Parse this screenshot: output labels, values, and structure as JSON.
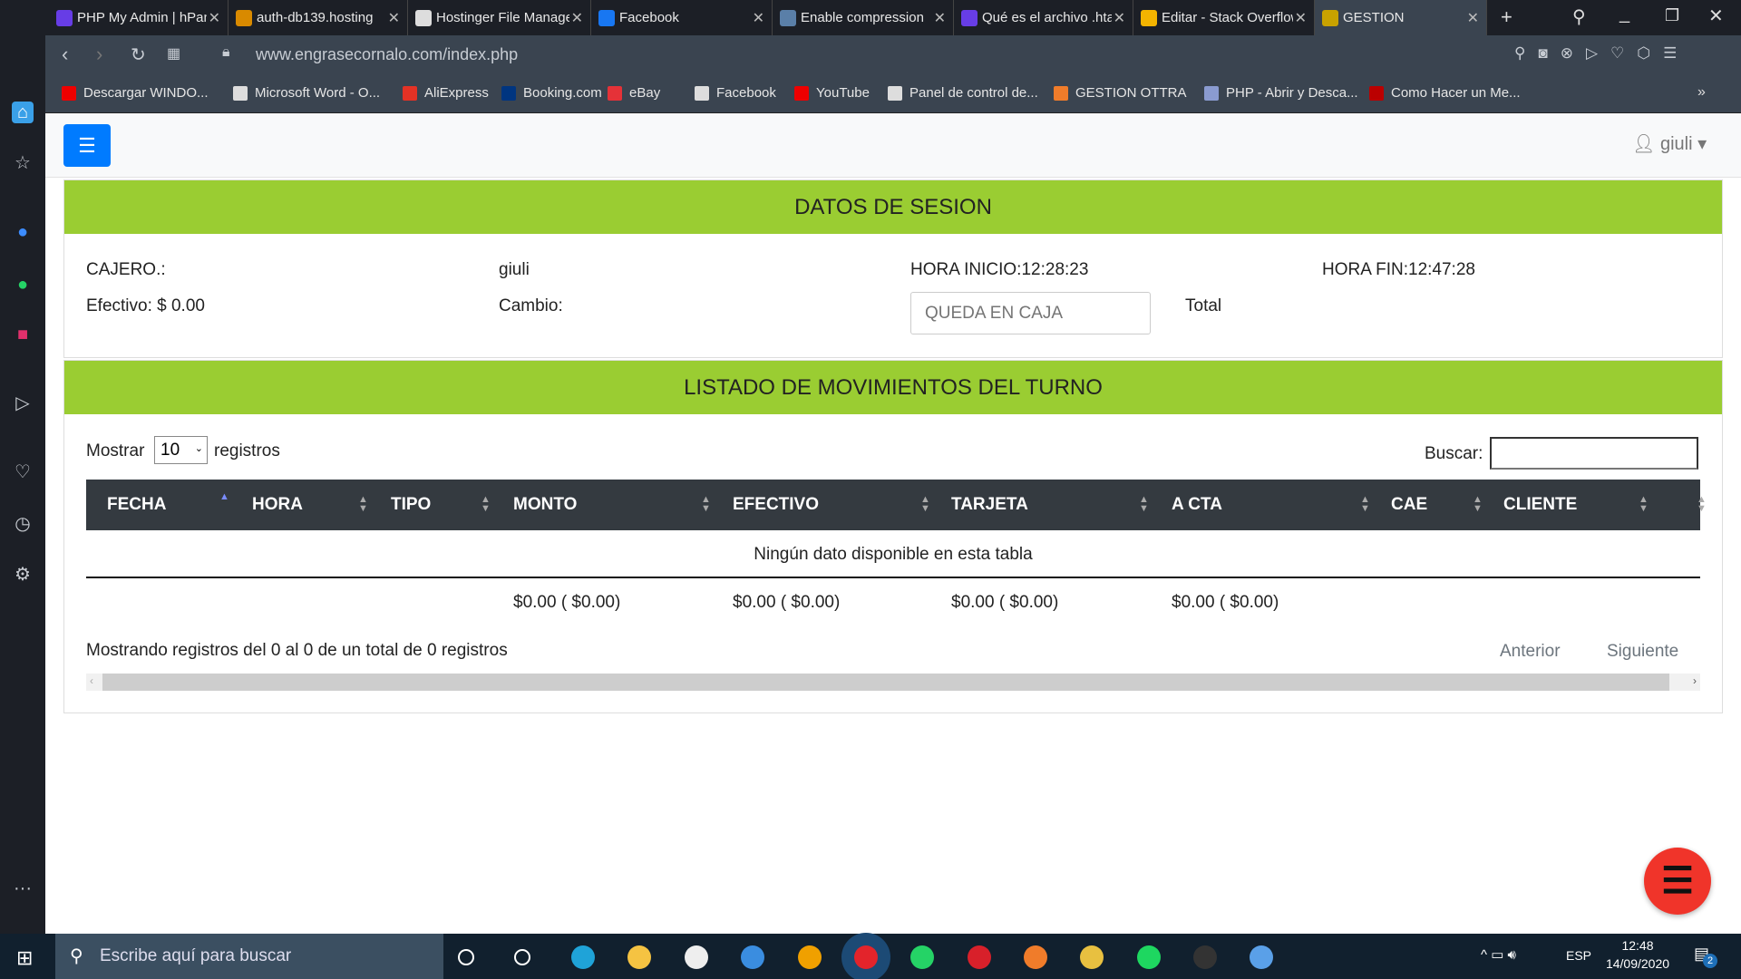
{
  "browser": {
    "tabs": [
      {
        "title": "PHP My Admin | hPanel",
        "color": "#673de6"
      },
      {
        "title": "auth-db139.hosting",
        "color": "#d98a00"
      },
      {
        "title": "Hostinger File Manager",
        "color": "#ddd"
      },
      {
        "title": "Facebook",
        "color": "#1877f2"
      },
      {
        "title": "Enable compression",
        "color": "#5a7fa8"
      },
      {
        "title": "Qué es el archivo .htaccess",
        "color": "#673de6"
      },
      {
        "title": "Editar - Stack Overflow",
        "color": "#f4b400"
      },
      {
        "title": "GESTION",
        "color": "#c8a200"
      }
    ],
    "url": "www.engrasecornalo.com/index.php",
    "bookmarks": [
      {
        "label": "Descargar WINDO...",
        "color": "#e00"
      },
      {
        "label": "Microsoft Word - O...",
        "color": "#ddd"
      },
      {
        "label": "AliExpress",
        "color": "#e43225"
      },
      {
        "label": "Booking.com",
        "color": "#003580"
      },
      {
        "label": "eBay",
        "color": "#e53238"
      },
      {
        "label": "Facebook",
        "color": "#ddd"
      },
      {
        "label": "YouTube",
        "color": "#e00"
      },
      {
        "label": "Panel de control de...",
        "color": "#ddd"
      },
      {
        "label": "GESTION OTTRA",
        "color": "#f07c2a"
      },
      {
        "label": "PHP - Abrir y Desca...",
        "color": "#8a9bd0"
      },
      {
        "label": "Como Hacer un Me...",
        "color": "#b00"
      }
    ]
  },
  "nav": {
    "user": "giuli"
  },
  "session": {
    "title": "DATOS DE SESION",
    "cajero_label": "CAJERO.:",
    "cajero": "giuli",
    "hora_inicio": "HORA INICIO:12:28:23",
    "hora_fin": "HORA FIN:12:47:28",
    "efectivo": "Efectivo: $ 0.00",
    "cambio": "Cambio:",
    "queda_placeholder": "QUEDA EN CAJA",
    "total": "Total"
  },
  "list": {
    "title": "LISTADO DE MOVIMIENTOS DEL TURNO",
    "show_label": "Mostrar",
    "show_value": "10",
    "show_suffix": "registros",
    "search_label": "Buscar:",
    "columns": [
      "FECHA",
      "HORA",
      "TIPO",
      "MONTO",
      "EFECTIVO",
      "TARJETA",
      "A CTA",
      "CAE",
      "CLIENTE"
    ],
    "empty": "Ningún dato disponible en esta tabla",
    "totals": [
      "$0.00 ( $0.00)",
      "$0.00 ( $0.00)",
      "$0.00 ( $0.00)",
      "$0.00 ( $0.00)"
    ],
    "info": "Mostrando registros del 0 al 0 de un total de 0 registros",
    "prev": "Anterior",
    "next": "Siguiente"
  },
  "taskbar": {
    "search_placeholder": "Escribe aquí para buscar",
    "time": "12:48",
    "date": "14/09/2020",
    "lang": "ESP",
    "notifications": "2"
  },
  "colors": {
    "accent": "#9acd32",
    "header_dark": "#343a40",
    "primary_button": "#007bff",
    "fab": "#f0342a"
  }
}
